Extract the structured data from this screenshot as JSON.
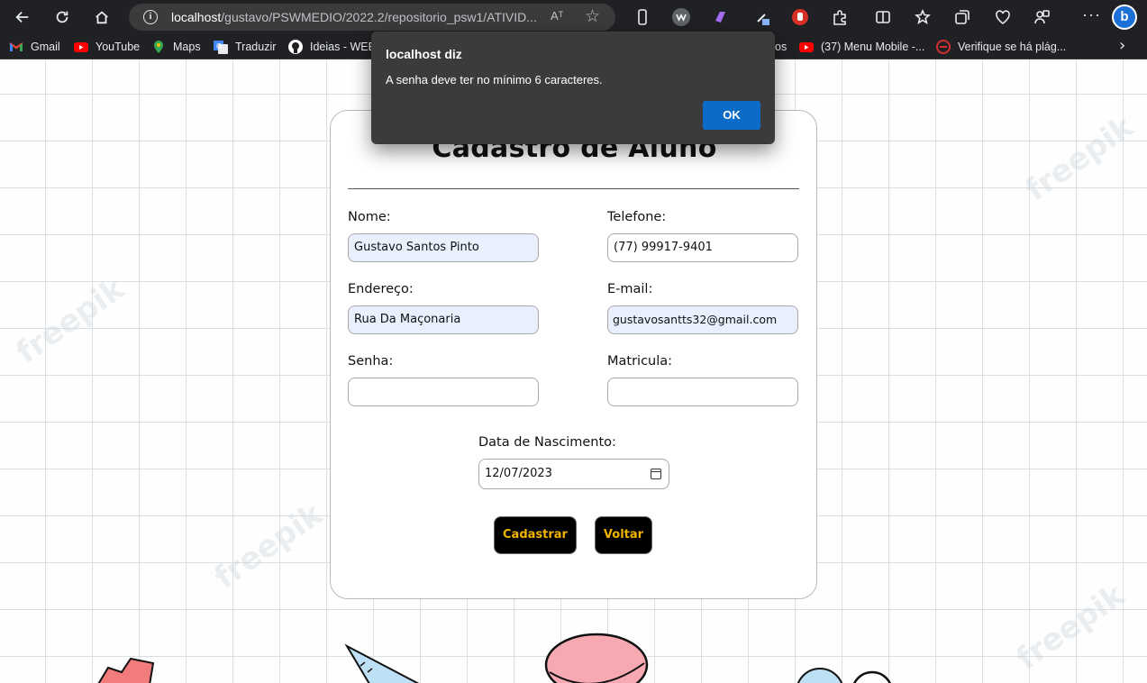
{
  "browser": {
    "url_host": "localhost",
    "url_path": "/gustavo/PSWMEDIO/2022.2/repositorio_psw1/ATIVID...",
    "reader_label": "Aᵀ",
    "more_label": "···",
    "bing_label": "b"
  },
  "bookmarks": [
    {
      "label": "Gmail",
      "icon": "gmail-icon",
      "color": "#ea4335"
    },
    {
      "label": "YouTube",
      "icon": "youtube-icon",
      "color": "#ff0000"
    },
    {
      "label": "Maps",
      "icon": "maps-icon",
      "color": "#34a853"
    },
    {
      "label": "Traduzir",
      "icon": "translate-icon",
      "color": "#4285f4"
    },
    {
      "label": "Ideias - WEB",
      "icon": "github-icon",
      "color": "#ffffff"
    },
    {
      "label": "os",
      "icon": "",
      "color": ""
    },
    {
      "label": "(37) Menu Mobile -...",
      "icon": "youtube-icon",
      "color": "#ff0000"
    },
    {
      "label": "Verifique se há plág...",
      "icon": "plagiarism-icon",
      "color": "#d32f2f"
    }
  ],
  "dialog": {
    "title": "localhost diz",
    "message": "A senha deve ter no mínimo 6 caracteres.",
    "ok_label": "OK"
  },
  "form": {
    "title": "Cadastro de Aluno",
    "nome_label": "Nome:",
    "nome_value": "Gustavo Santos Pinto",
    "telefone_label": "Telefone:",
    "telefone_value": "(77) 99917-9401",
    "endereco_label": "Endereço:",
    "endereco_value": "Rua Da Maçonaria",
    "email_label": "E-mail:",
    "email_value": "gustavosantts32@gmail.com",
    "senha_label": "Senha:",
    "senha_value": "",
    "matricula_label": "Matricula:",
    "matricula_value": "",
    "nascimento_label": "Data de Nascimento:",
    "nascimento_value": "12/07/2023",
    "cadastrar_label": "Cadastrar",
    "voltar_label": "Voltar"
  },
  "watermark": "freepik"
}
